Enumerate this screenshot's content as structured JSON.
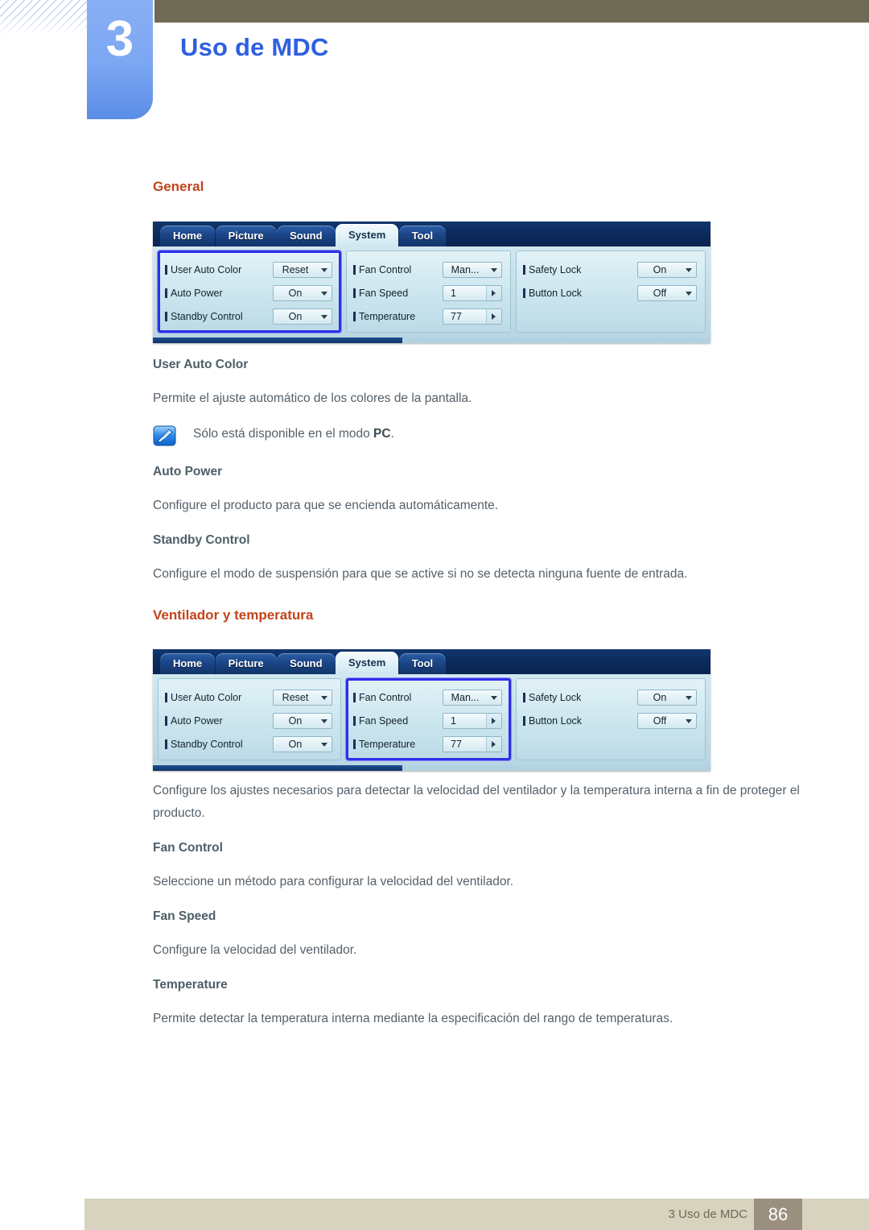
{
  "header": {
    "chapter_number": "3",
    "chapter_title": "Uso de MDC"
  },
  "sections": {
    "general_title": "General",
    "fan_title": "Ventilador y temperatura"
  },
  "topics": {
    "user_auto_color": {
      "heading": "User Auto Color",
      "body": "Permite el ajuste automático de los colores de la pantalla.",
      "note": "Sólo está disponible en el modo ",
      "note_bold": "PC",
      "note_end": "."
    },
    "auto_power": {
      "heading": "Auto Power",
      "body": "Configure el producto para que se encienda automáticamente."
    },
    "standby_control": {
      "heading": "Standby Control",
      "body": "Configure el modo de suspensión para que se active si no se detecta ninguna fuente de entrada."
    },
    "fan_intro": {
      "body": "Configure los ajustes necesarios para detectar la velocidad del ventilador y la temperatura interna a fin de proteger el producto."
    },
    "fan_control": {
      "heading": "Fan Control",
      "body": "Seleccione un método para configurar la velocidad del ventilador."
    },
    "fan_speed": {
      "heading": "Fan Speed",
      "body": "Configure la velocidad del ventilador."
    },
    "temperature": {
      "heading": "Temperature",
      "body": "Permite detectar la temperatura interna mediante la especificación del rango de temperaturas."
    }
  },
  "mdc": {
    "tabs": [
      {
        "label": "Home",
        "active": false
      },
      {
        "label": "Picture",
        "active": false
      },
      {
        "label": "Sound",
        "active": false
      },
      {
        "label": "System",
        "active": true
      },
      {
        "label": "Tool",
        "active": false
      }
    ],
    "panel_left": {
      "rows": [
        {
          "label": "User Auto Color",
          "value": "Reset",
          "type": "dropdown"
        },
        {
          "label": "Auto Power",
          "value": "On",
          "type": "dropdown"
        },
        {
          "label": "Standby Control",
          "value": "On",
          "type": "dropdown"
        }
      ]
    },
    "panel_middle": {
      "rows": [
        {
          "label": "Fan Control",
          "value": "Man...",
          "type": "dropdown"
        },
        {
          "label": "Fan Speed",
          "value": "1",
          "type": "spinner"
        },
        {
          "label": "Temperature",
          "value": "77",
          "type": "spinner"
        }
      ]
    },
    "panel_right": {
      "rows": [
        {
          "label": "Safety Lock",
          "value": "On",
          "type": "dropdown"
        },
        {
          "label": "Button Lock",
          "value": "Off",
          "type": "dropdown"
        }
      ]
    },
    "selection_first": "panel_left",
    "selection_second": "panel_middle"
  },
  "footer": {
    "label": "3 Uso de MDC",
    "page": "86"
  },
  "colors": {
    "accent_orange": "#c1441a",
    "chapter_blue": "#2f5fe0",
    "tab_blue": "#7ba6f2",
    "topbar_olive": "#6e6a56",
    "footer_tan": "#d7d3bf",
    "page_box": "#9b9080",
    "selection_blue": "#2f2fe8",
    "body_text": "#55606a"
  }
}
